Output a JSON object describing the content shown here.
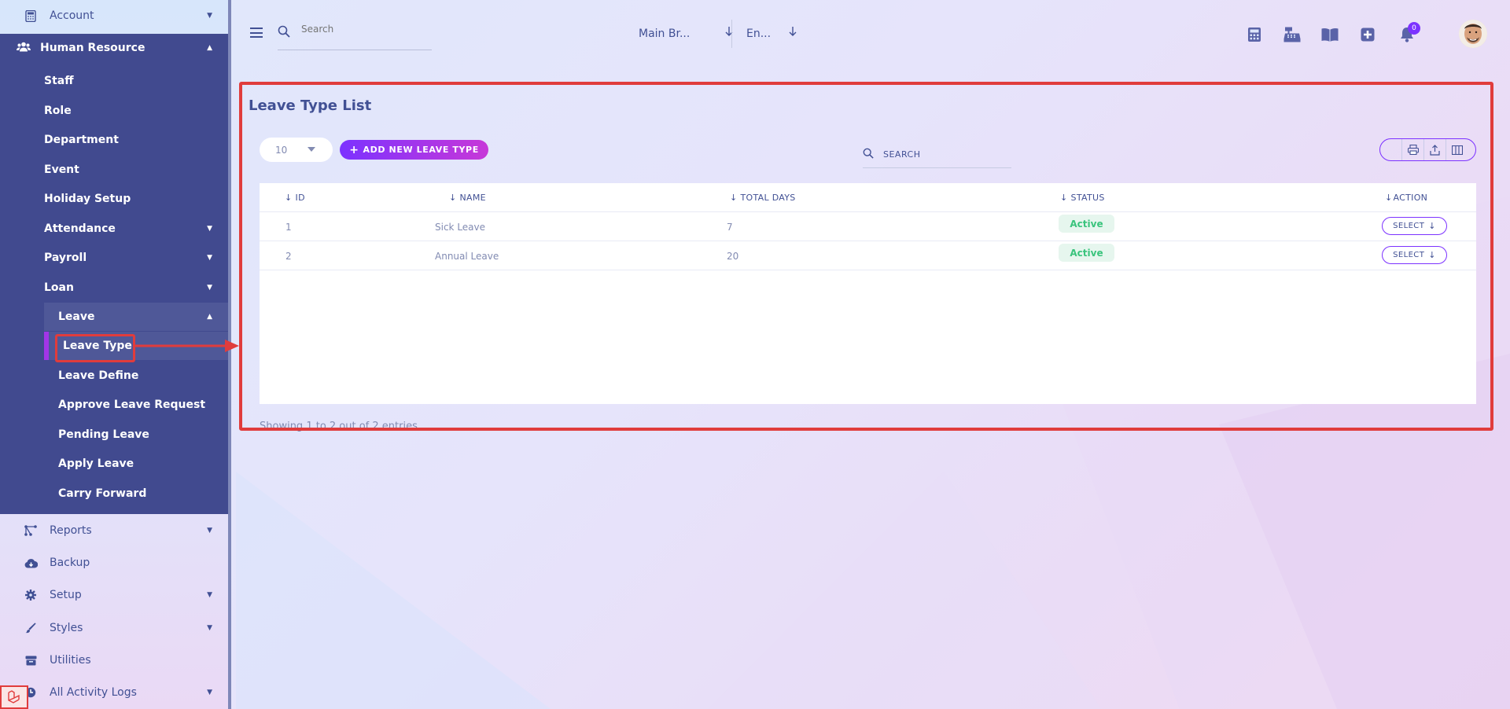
{
  "sidebar": {
    "top_items": [
      {
        "label": "Account",
        "icon": "calculator-icon"
      }
    ],
    "hr": {
      "label": "Human Resource",
      "icon": "users-icon",
      "items": [
        {
          "label": "Staff"
        },
        {
          "label": "Role"
        },
        {
          "label": "Department"
        },
        {
          "label": "Event"
        },
        {
          "label": "Holiday Setup"
        },
        {
          "label": "Attendance"
        },
        {
          "label": "Payroll"
        },
        {
          "label": "Loan"
        }
      ],
      "leave": {
        "label": "Leave",
        "items": [
          {
            "label": "Leave Type"
          },
          {
            "label": "Leave Define"
          },
          {
            "label": "Approve Leave Request"
          },
          {
            "label": "Pending Leave"
          },
          {
            "label": "Apply Leave"
          },
          {
            "label": "Carry Forward"
          }
        ]
      }
    },
    "bottom_items": [
      {
        "label": "Reports",
        "icon": "reports-icon"
      },
      {
        "label": "Backup",
        "icon": "cloud-download-icon"
      },
      {
        "label": "Setup",
        "icon": "gear-icon"
      },
      {
        "label": "Styles",
        "icon": "brush-icon"
      },
      {
        "label": "Utilities",
        "icon": "box-icon"
      },
      {
        "label": "All Activity Logs",
        "icon": "clock-icon"
      }
    ]
  },
  "topbar": {
    "search_placeholder": "Search",
    "branch": "Main Br...",
    "language": "En...",
    "notification_count": "0",
    "icons": [
      "calculator-icon",
      "cash-register-icon",
      "book-icon",
      "plus-square-icon",
      "bell-icon"
    ]
  },
  "main": {
    "title": "Leave Type List",
    "per_page": "10",
    "add_button": "ADD NEW LEAVE TYPE",
    "search_label": "SEARCH",
    "columns": [
      "ID",
      "NAME",
      "TOTAL DAYS",
      "STATUS",
      "ACTION"
    ],
    "rows": [
      {
        "id": "1",
        "name": "Sick Leave",
        "total_days": "7",
        "status": "Active",
        "action": "SELECT"
      },
      {
        "id": "2",
        "name": "Annual Leave",
        "total_days": "20",
        "status": "Active",
        "action": "SELECT"
      }
    ],
    "footer": "Showing 1 to 2 out of 2 entries"
  },
  "colors": {
    "sidebar_active": "#414a8f",
    "accent": "#7c32ff",
    "status_active": "#3ac47d",
    "highlight": "#e03c3c"
  }
}
